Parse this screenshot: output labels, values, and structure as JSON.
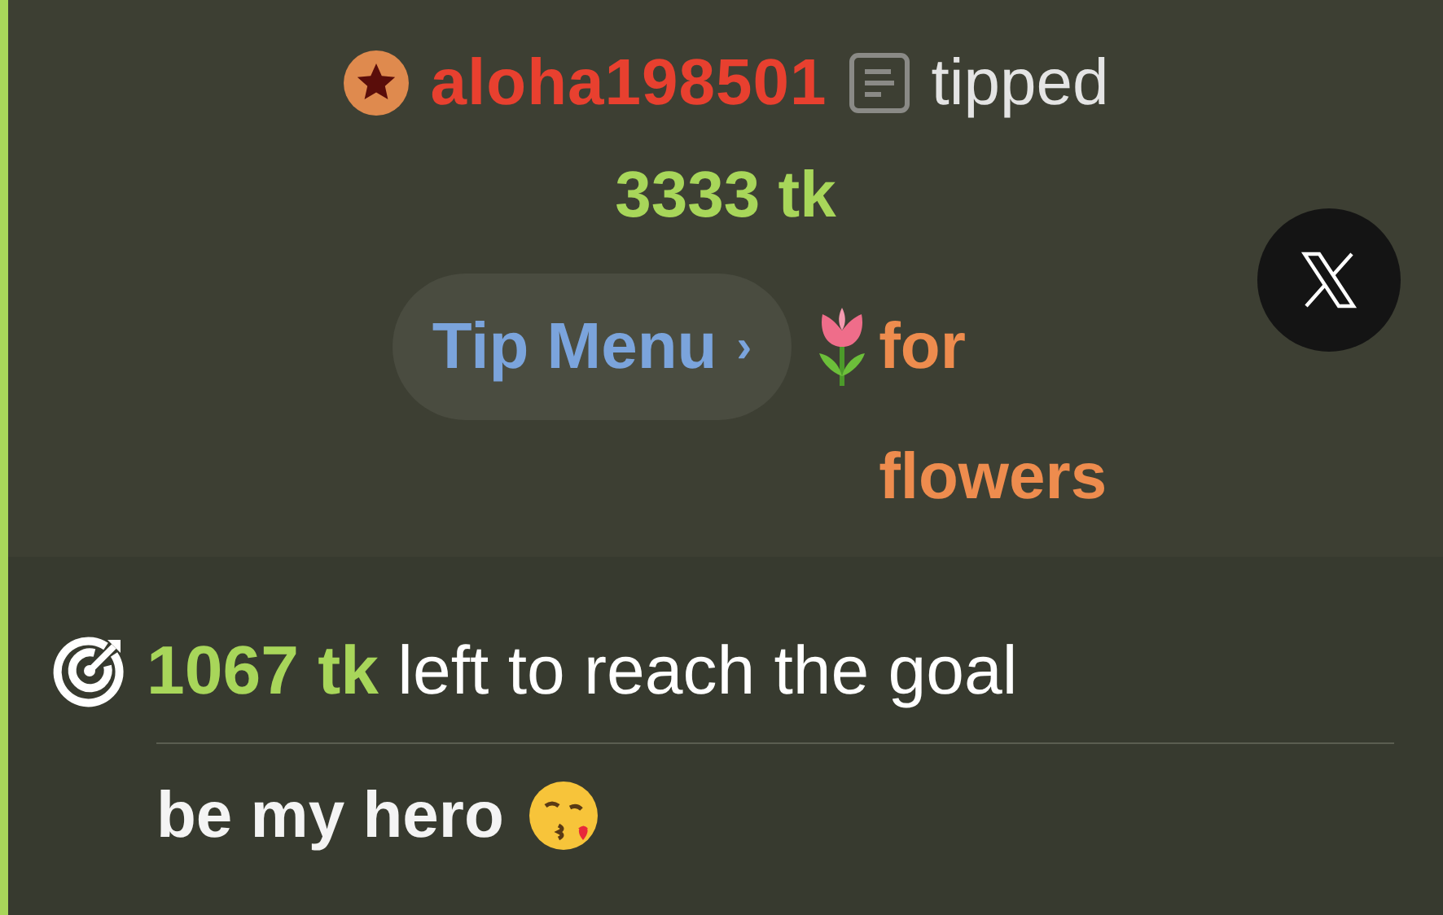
{
  "tip": {
    "username": "aloha198501",
    "action": "tipped",
    "amount": "3333 tk",
    "tip_menu": {
      "label": "Tip Menu",
      "chevron": "›"
    },
    "message": "for flowers"
  },
  "goal": {
    "remaining": "1067 tk",
    "text": "left to reach the goal",
    "description": "be my hero"
  }
}
